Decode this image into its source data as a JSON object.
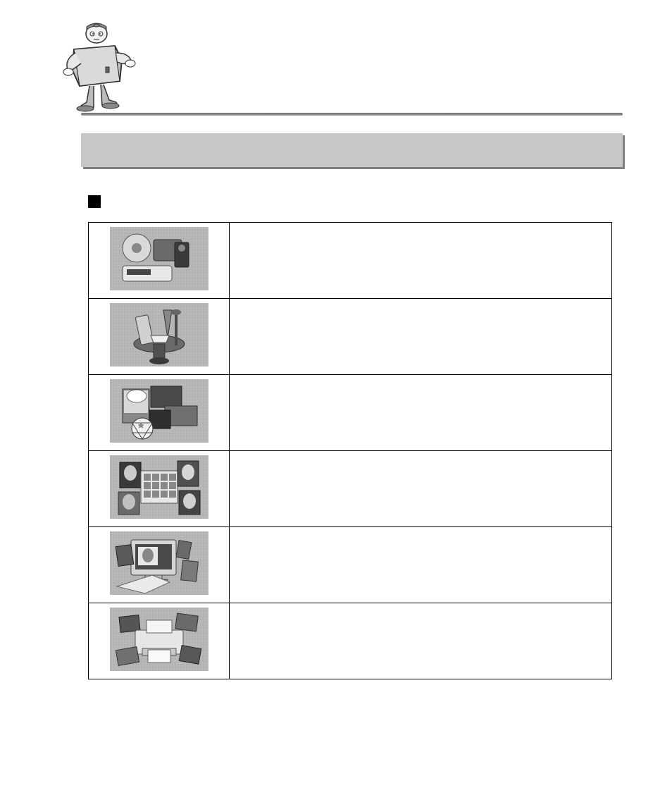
{
  "titleBar": "",
  "bulletLabel": "",
  "rows": [
    {
      "icon": "devices-icon",
      "desc": ""
    },
    {
      "icon": "tools-icon",
      "desc": ""
    },
    {
      "icon": "clipart-icon",
      "desc": ""
    },
    {
      "icon": "album-icon",
      "desc": ""
    },
    {
      "icon": "monitor-icon",
      "desc": ""
    },
    {
      "icon": "printer-icon",
      "desc": ""
    }
  ]
}
